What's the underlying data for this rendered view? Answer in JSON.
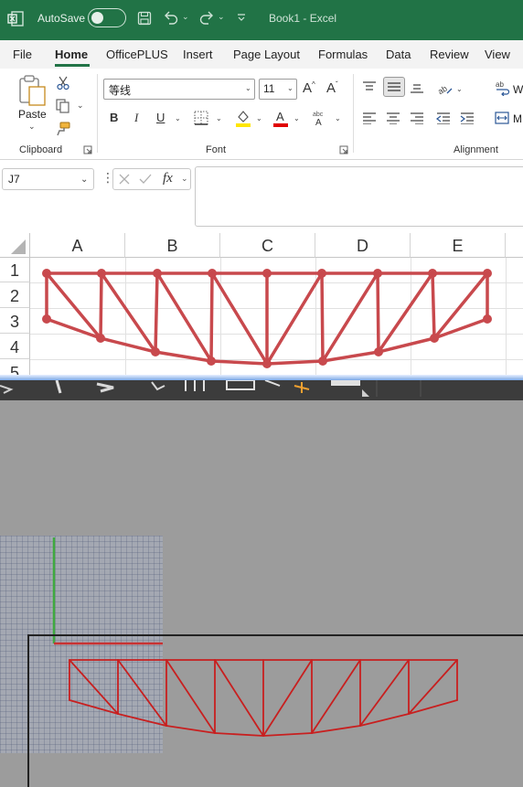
{
  "titlebar": {
    "autosave_label": "AutoSave",
    "doc_title": "Book1  -  Excel"
  },
  "menu": [
    {
      "label": "File"
    },
    {
      "label": "Home"
    },
    {
      "label": "OfficePLUS"
    },
    {
      "label": "Insert"
    },
    {
      "label": "Page Layout"
    },
    {
      "label": "Formulas"
    },
    {
      "label": "Data"
    },
    {
      "label": "Review"
    },
    {
      "label": "View"
    }
  ],
  "ribbon": {
    "paste_label": "Paste",
    "clipboard_label": "Clipboard",
    "font_label": "Font",
    "alignment_label": "Alignment",
    "font_name": "等线",
    "font_size": "11",
    "wrap_partial": "W",
    "merge_partial": "M",
    "accent_colors": {
      "highlight": "#ffe600",
      "font_color": "#e00000"
    }
  },
  "formula_bar": {
    "name_box": "J7",
    "fx_label": "fx",
    "formula_value": ""
  },
  "sheet": {
    "columns": [
      "A",
      "B",
      "C",
      "D",
      "E"
    ],
    "rows": [
      "1",
      "2",
      "3",
      "4",
      "5"
    ]
  },
  "truss_color": "#c8494d",
  "cad_colors": {
    "y_axis": "#3faa3f",
    "x_axis": "#c83232",
    "truss": "#c81f1f"
  }
}
